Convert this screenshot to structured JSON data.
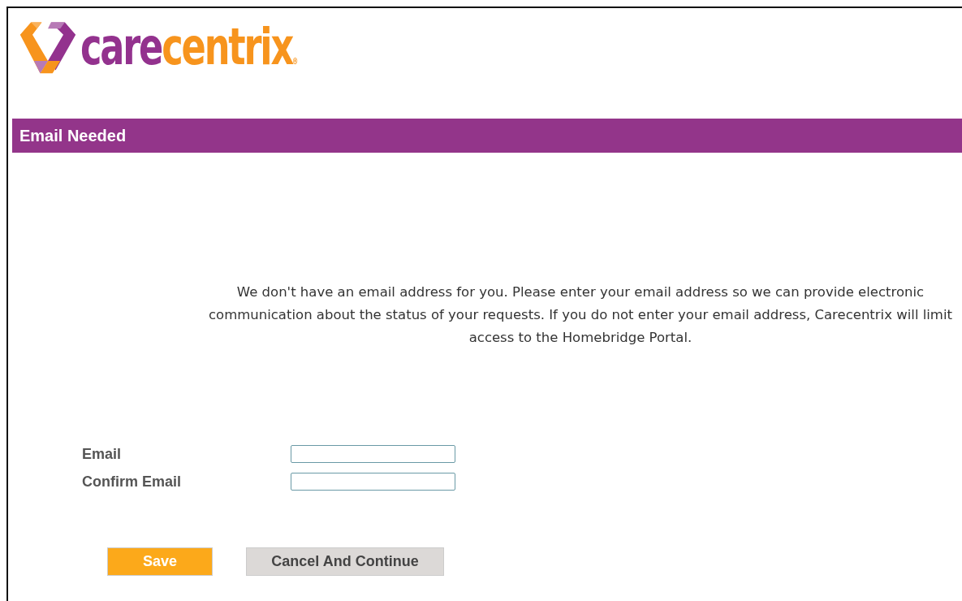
{
  "logo": {
    "brand_first": "care",
    "brand_second": "centrix",
    "mark": "®"
  },
  "header": {
    "title": "Email Needed"
  },
  "message": "We don't have an email address for you. Please enter your email address so we can provide electronic communication about the status of your requests. If you do not enter your email address, Carecentrix will limit access to the Homebridge Portal.",
  "fields": [
    {
      "label": "Email"
    },
    {
      "label": "Confirm Email"
    }
  ],
  "buttons": [
    {
      "label": "Save",
      "kind": "primary"
    },
    {
      "label": "Cancel And Continue",
      "kind": "secondary"
    }
  ]
}
